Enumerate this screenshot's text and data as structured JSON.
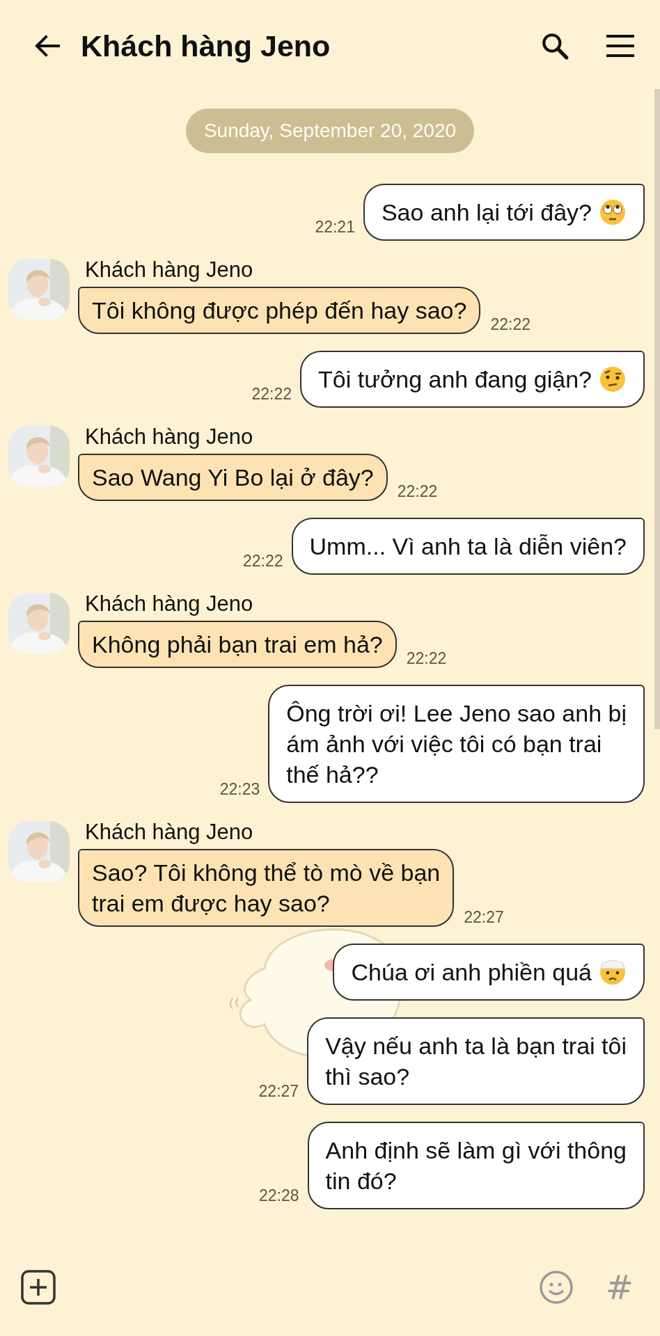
{
  "header": {
    "title": "Khách hàng Jeno"
  },
  "date_divider": "Sunday, September 20, 2020",
  "messages": [
    {
      "kind": "sent",
      "text": "Sao anh lại tới đây?",
      "emoji": {
        "kind": "rolling_eyes"
      },
      "time": "22:21"
    },
    {
      "kind": "received",
      "sender": "Khách hàng Jeno",
      "text": "Tôi không được phép đến hay sao?",
      "time": "22:22"
    },
    {
      "kind": "sent",
      "text": "Tôi tưởng anh đang giận?",
      "emoji": {
        "kind": "raised_eyebrow"
      },
      "time": "22:22"
    },
    {
      "kind": "received",
      "sender": "Khách hàng Jeno",
      "text": "Sao Wang Yi Bo lại ở đây?",
      "time": "22:22"
    },
    {
      "kind": "sent",
      "text": "Umm... Vì anh ta là diễn viên?",
      "time": "22:22"
    },
    {
      "kind": "received",
      "sender": "Khách hàng Jeno",
      "text": "Không phải bạn trai em hả?",
      "time": "22:22"
    },
    {
      "kind": "sent",
      "text": "Ông trời ơi! Lee Jeno sao anh bị\nám ảnh với việc tôi có bạn trai\nthế hả??",
      "time": "22:23"
    },
    {
      "kind": "received",
      "sender": "Khách hàng Jeno",
      "text": "Sao? Tôi không thể tò mò về bạn\ntrai em được hay sao?",
      "time": "22:27"
    },
    {
      "kind": "sent",
      "text": "Chúa ơi anh phiền quá",
      "emoji": {
        "kind": "head_bandage"
      }
    },
    {
      "kind": "sent",
      "text": "Vậy nếu anh ta là bạn trai tôi\nthì sao?",
      "time": "22:27"
    },
    {
      "kind": "sent",
      "text": "Anh định sẽ làm gì với thông\ntin đó?",
      "time": "22:28"
    }
  ],
  "composer": {
    "hashtag": "#"
  }
}
